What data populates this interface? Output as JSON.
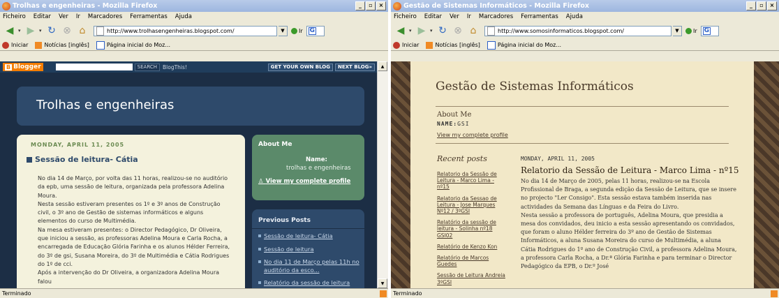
{
  "colors": {
    "titlebar": "#9db6df",
    "blogger_bg": "#1c2e45",
    "blogger_post": "#f4f2dd",
    "about_bg": "#5b8a6a",
    "parchment": "#f2e8c8"
  },
  "window1": {
    "title": "Trolhas e engenheiras - Mozilla Firefox",
    "menu": [
      "Ficheiro",
      "Editar",
      "Ver",
      "Ir",
      "Marcadores",
      "Ferramentas",
      "Ajuda"
    ],
    "url": "http://www.trolhasengenheiras.blogspot.com/",
    "go_label": "Ir",
    "bookmarks": [
      "Iniciar",
      "Notícias [inglês]",
      "Página inicial do Moz..."
    ],
    "blogger_bar": {
      "logo": "Blogger",
      "search": "SEARCH",
      "blogthis": "BlogThis!",
      "get_blog": "GET YOUR OWN BLOG",
      "next_blog": "NEXT BLOG»"
    },
    "blog_title": "Trolhas e engenheiras",
    "post": {
      "date": "MONDAY, APRIL 11, 2005",
      "title": "Sessão de leitura- Cátia",
      "paragraphs": [
        "No dia 14 de Março, por volta das 11 horas, realizou-se no auditório da epb, uma sessão de leitura, organizada pela professora Adelina Moura.",
        "Nesta sessão estiveram presentes os 1º e 3º anos de Construção civil, o 3º ano de Gestão de sistemas informáticos e alguns elementos do curso de Multimédia.",
        "Na mesa estiveram presentes: o Director Pedagógico, Dr Oliveira, que iniciou a sessão, as professoras Adelina Moura e Carla Rocha, a encarregada de Educação Glória Farinha e os alunos Hélder Ferreira, do 3º de gsi, Susana Moreira, do 3º de Multimédia e Cátia Rodrigues do 1º de cci.",
        "Após a intervenção do Dr Oliveira, a organizadora Adelina Moura falou"
      ]
    },
    "about": {
      "heading": "About Me",
      "name_label": "Name:",
      "name_value": "trolhas e engenheiras",
      "profile_link": "View my complete profile"
    },
    "previous": {
      "heading": "Previous Posts",
      "items": [
        "Sessão de leitura- Cátia",
        "Sessão de leitura",
        "No dia 11 de Março pelas 11h no auditório da esco...",
        "Relatório da sessão de leitura"
      ]
    },
    "status": "Terminado"
  },
  "window2": {
    "title": "Gestão de Sistemas Informáticos - Mozilla Firefox",
    "menu": [
      "Ficheiro",
      "Editar",
      "Ver",
      "Ir",
      "Marcadores",
      "Ferramentas",
      "Ajuda"
    ],
    "url": "http://www.somosinformaticos.blogspot.com/",
    "go_label": "Ir",
    "bookmarks": [
      "Iniciar",
      "Notícias [inglês]",
      "Página inicial do Moz..."
    ],
    "blog_title": "Gestão de Sistemas Informáticos",
    "about_me": "About Me",
    "name_label": "NAME:",
    "name_value": "GSI",
    "profile_link": "View my complete profile",
    "recent_heading": "Recent posts",
    "recent_posts": [
      "Relatorio da Sessão de Leitura - Marco Lima - nº15",
      "Relatorio da Sessao de Leitura - Jose Marques Nº12 / 3ºGSI",
      "Relatório da sessão de leitura - Solinha nº18 GSI02",
      "Relatório de Kenzo Kon",
      "Relatório de Marcos Guedes",
      "Sessão de Leitura Andreia 3ºGSI"
    ],
    "post": {
      "date": "MONDAY, APRIL 11, 2005",
      "title": "Relatorio da Sessão de Leitura - Marco Lima - nº15",
      "paragraphs": [
        "No dia 14 de Março de 2005, pelas 11 horas, realizou-se na Escola Profissional de Braga, a segunda edição da Sessão de Leitura, que se insere no projecto \"Ler Consigo\". Esta sessão estava também inserida nas actividades da Semana das Línguas e da Feira do Livro.",
        "Nesta sessão a professora de português, Adelina Moura, que presidia a mesa dos convidados, deu inicio a esta sessão apresentando os convidados, que foram o aluno Hélder ferreira do 3º ano de Gestão de Sistemas Informáticos, a aluna Susana Moreira do curso de Multimédia, a aluna Cátia Rodrigues do 1º ano de Construção Civil, a professora Adelina Moura, a professora Carla Rocha, a Dr.ª Glória Farinha e para terminar o Director Pedagógico da EPB, o Dr.º José"
      ]
    },
    "status": "Terminado"
  }
}
